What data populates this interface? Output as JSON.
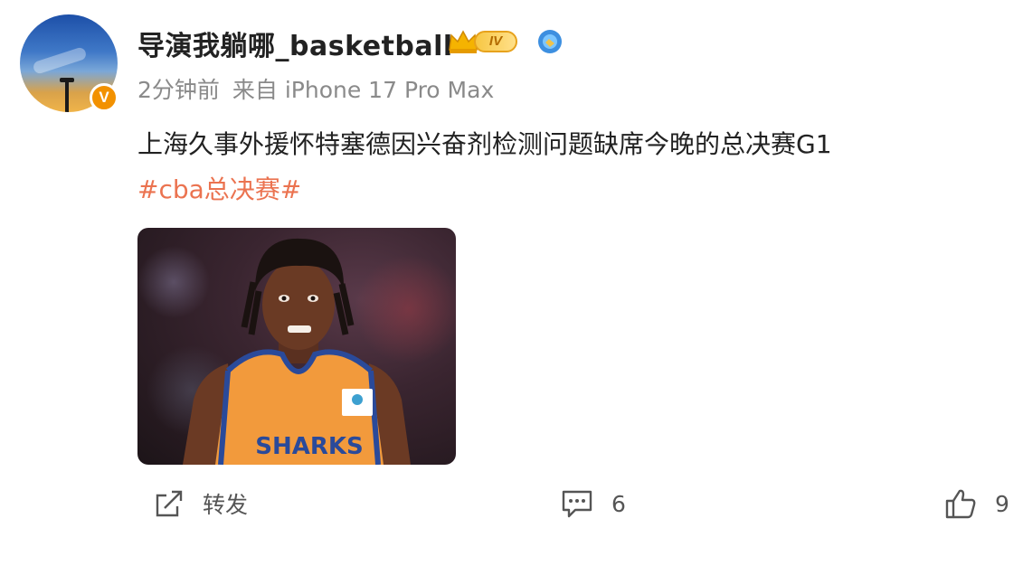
{
  "user": {
    "name": "导演我躺哪_basketball",
    "verified_badge": "V",
    "level_badge": "IV",
    "icons": [
      "verified-v-icon",
      "crown-level-icon",
      "blue-emblem-icon"
    ]
  },
  "meta": {
    "time": "2分钟前",
    "source": "来自 iPhone 17 Pro Max"
  },
  "post": {
    "text": "上海久事外援怀特塞德因兴奋剂检测问题缺席今晚的总决赛G1",
    "hashtag": "#cba总决赛#",
    "image": {
      "jersey_text": "SHARKS"
    }
  },
  "actions": {
    "repost_label": "转发",
    "comment_count": "6",
    "like_count": "9",
    "icons": [
      "repost-icon",
      "comment-icon",
      "like-icon"
    ]
  },
  "colors": {
    "hashtag": "#eb7350",
    "meta": "#8a8a8a",
    "verified": "#f29100"
  }
}
